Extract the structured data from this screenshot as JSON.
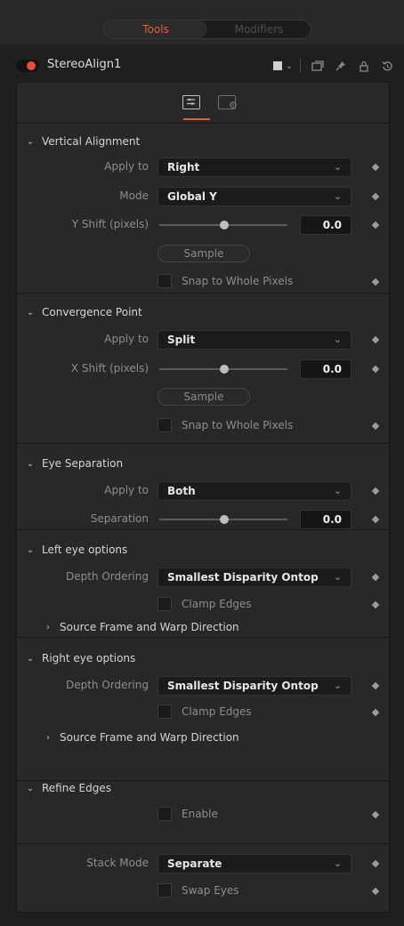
{
  "tabs": {
    "active": "Tools",
    "inactive": "Modifiers"
  },
  "tool": {
    "name": "StereoAlign1",
    "enabled_color": "#e64b3c"
  },
  "accent": "#e0603a",
  "sections": {
    "vertical": {
      "title": "Vertical Alignment",
      "apply_label": "Apply to",
      "apply_value": "Right",
      "mode_label": "Mode",
      "mode_value": "Global Y",
      "shift_label": "Y Shift (pixels)",
      "shift_value": "0.0",
      "sample_label": "Sample",
      "snap_label": "Snap to Whole Pixels"
    },
    "convergence": {
      "title": "Convergence Point",
      "apply_label": "Apply to",
      "apply_value": "Split",
      "shift_label": "X Shift (pixels)",
      "shift_value": "0.0",
      "sample_label": "Sample",
      "snap_label": "Snap to Whole Pixels"
    },
    "eye_sep": {
      "title": "Eye Separation",
      "apply_label": "Apply to",
      "apply_value": "Both",
      "sep_label": "Separation",
      "sep_value": "0.0"
    },
    "left_eye": {
      "title": "Left eye options",
      "depth_label": "Depth Ordering",
      "depth_value": "Smallest Disparity Ontop",
      "clamp_label": "Clamp Edges",
      "sub_label": "Source Frame and Warp Direction"
    },
    "right_eye": {
      "title": "Right eye options",
      "depth_label": "Depth Ordering",
      "depth_value": "Smallest Disparity Ontop",
      "clamp_label": "Clamp Edges",
      "sub_label": "Source Frame and Warp Direction"
    },
    "refine": {
      "title": "Refine Edges",
      "enable_label": "Enable"
    },
    "stack": {
      "mode_label": "Stack Mode",
      "mode_value": "Separate",
      "swap_label": "Swap Eyes"
    }
  }
}
